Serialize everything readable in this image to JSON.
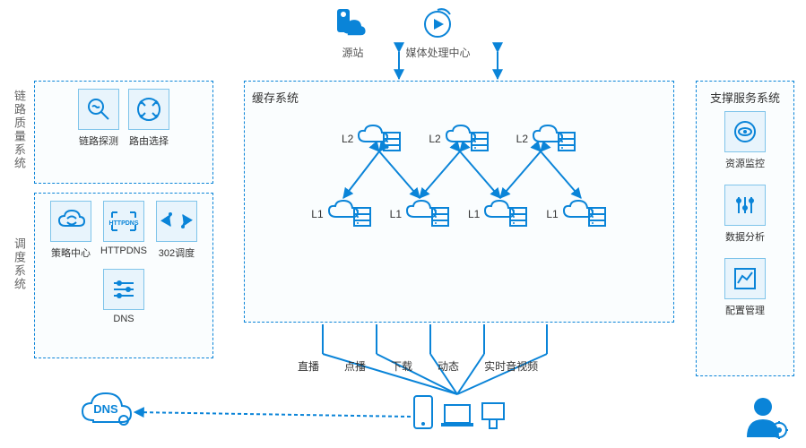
{
  "top": {
    "origin": "源站",
    "mediaCenter": "媒体处理中心"
  },
  "linkQuality": {
    "title": "链路质量系统",
    "items": [
      {
        "label": "链路探测",
        "icon": "link-probe"
      },
      {
        "label": "路由选择",
        "icon": "route-select"
      }
    ]
  },
  "dispatch": {
    "title": "调度系统",
    "items": [
      {
        "label": "策略中心",
        "icon": "strategy"
      },
      {
        "label": "HTTPDNS",
        "icon": "httpdns"
      },
      {
        "label": "302调度",
        "icon": "302"
      },
      {
        "label": "DNS",
        "icon": "dns"
      }
    ]
  },
  "cache": {
    "title": "缓存系统",
    "l2": [
      "L2",
      "L2",
      "L2"
    ],
    "l1": [
      "L1",
      "L1",
      "L1",
      "L1"
    ]
  },
  "support": {
    "title": "支撑服务系统",
    "items": [
      {
        "label": "资源监控",
        "icon": "monitor"
      },
      {
        "label": "数据分析",
        "icon": "analytics"
      },
      {
        "label": "配置管理",
        "icon": "config"
      }
    ]
  },
  "services": [
    "直播",
    "点播",
    "下载",
    "动态",
    "实时音视频"
  ],
  "dnsBubble": "DNS",
  "colors": {
    "primary": "#0a84d8"
  }
}
